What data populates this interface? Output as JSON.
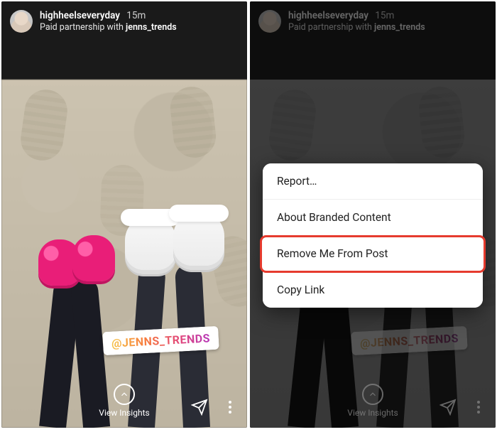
{
  "header": {
    "username": "highheelseveryday",
    "timestamp": "15m",
    "partnership_prefix": "Paid partnership with ",
    "partner": "jenns_trends"
  },
  "mention": "@JENNS_TRENDS",
  "bottom": {
    "insights_label": "View Insights"
  },
  "icons": {
    "chevron_up": "chevron-up-icon",
    "send": "send-icon",
    "more": "more-icon"
  },
  "sheet": {
    "items": [
      "Report…",
      "About Branded Content",
      "Remove Me From Post",
      "Copy Link"
    ],
    "highlighted_index": 2
  }
}
